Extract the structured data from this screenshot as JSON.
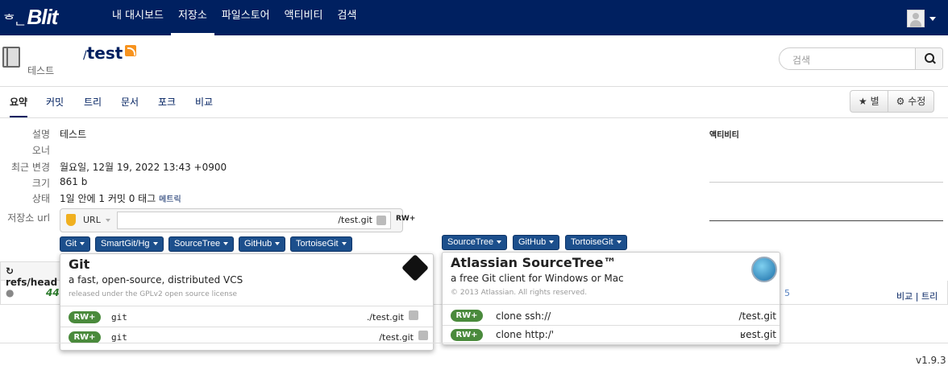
{
  "app": {
    "logo_prefix": "ᄒᆫ",
    "logo": "Blit"
  },
  "nav": {
    "items": [
      "내 대시보드",
      "저장소",
      "파일스토어",
      "액티비티",
      "검색"
    ],
    "active": "저장소"
  },
  "repo": {
    "slash": "/",
    "name": "test",
    "description": "테스트"
  },
  "search": {
    "placeholder": "검색"
  },
  "tabs": [
    "요약",
    "커밋",
    "트리",
    "문서",
    "포크",
    "비교"
  ],
  "actions": {
    "star_label": "★ 별",
    "edit_label": "⚙ 수정"
  },
  "summary": {
    "labels": [
      "설명",
      "오너",
      "최근 변경",
      "크기",
      "상태",
      "저장소 url"
    ],
    "description": "테스트",
    "owner": "",
    "last_change": "월요일, 12월 19, 2022 13:43 +0900",
    "size": "861 b",
    "status": "1일 안에 1 커밋 0 태그",
    "metrics_link": "메트릭"
  },
  "url_box": {
    "protocol": "URL",
    "value": "/test.git",
    "rw": "RW+"
  },
  "left_buttons": [
    "Git",
    "SmartGit/Hg",
    "SourceTree",
    "GitHub",
    "TortoiseGit"
  ],
  "right_buttons": [
    "SourceTree",
    "GitHub",
    "TortoiseGit"
  ],
  "git_panel": {
    "title": "Git",
    "subtitle": "a fast, open-source, distributed VCS",
    "license": "released under the GPLv2 open source license",
    "rows": [
      {
        "rw": "RW+",
        "cmd": "git",
        "url": "./test.git"
      },
      {
        "rw": "RW+",
        "cmd": "git",
        "url": "/test.git"
      }
    ]
  },
  "st_panel": {
    "title": "Atlassian SourceTree™",
    "subtitle": "a free Git client for Windows or Mac",
    "copyright": "© 2013 Atlassian. All rights reserved.",
    "rows": [
      {
        "rw": "RW+",
        "cmd": "clone ssh://",
        "url": "/test.git"
      },
      {
        "rw": "RW+",
        "cmd": "clone http:/'",
        "url": "ʁest.git"
      }
    ]
  },
  "refs": {
    "label": "refs/head",
    "row_text": "44",
    "link_tail": "5",
    "compare": "비교",
    "sep": "|",
    "tree": "트리"
  },
  "activity": {
    "title": "액티비티"
  },
  "footer": {
    "version": "v1.9.3"
  }
}
